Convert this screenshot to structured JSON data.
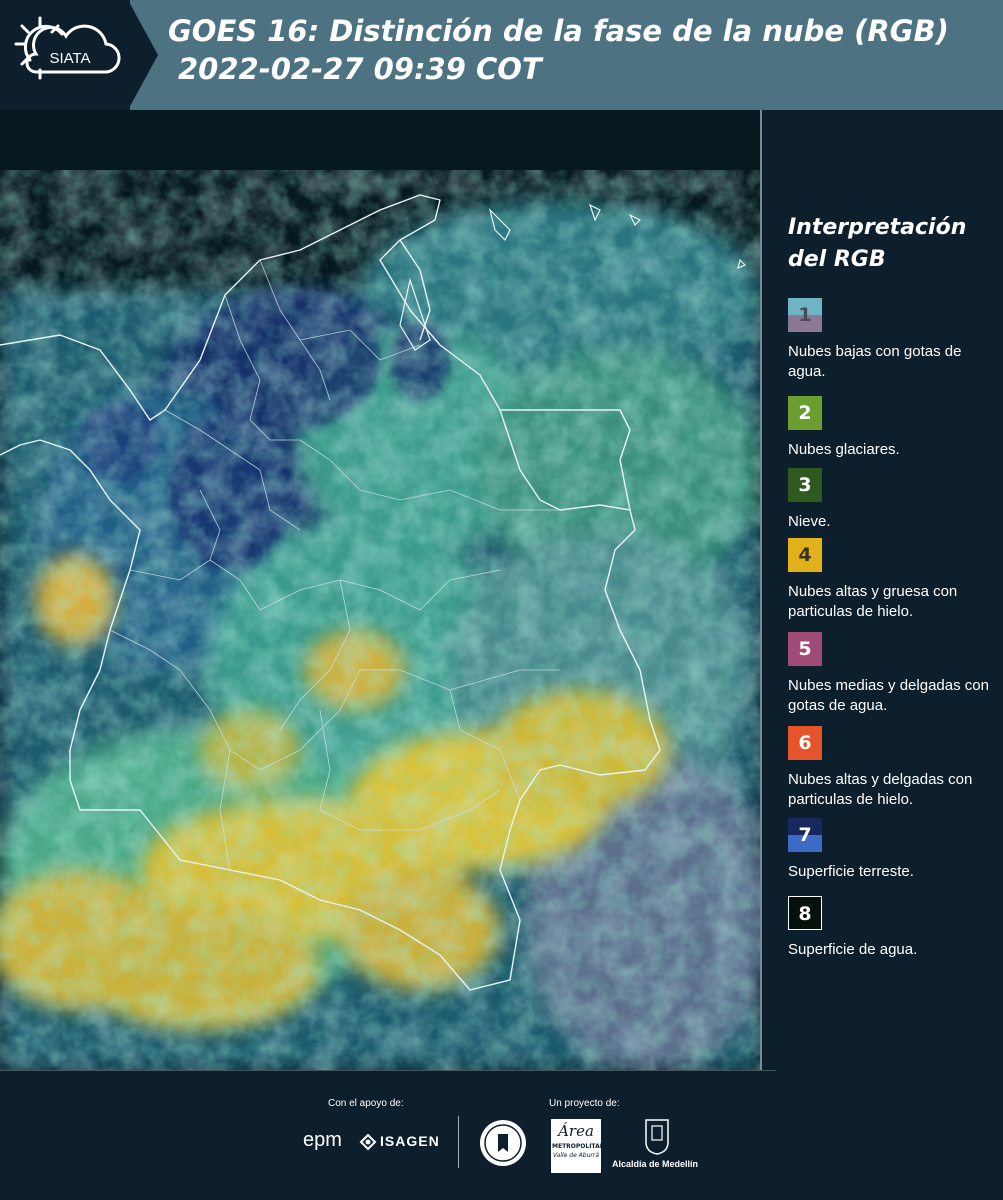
{
  "header": {
    "logo_text": "SIATA",
    "title_line1": "GOES 16: Distinción de la fase de la nube (RGB)",
    "title_line2": "2022-02-27 09:39 COT"
  },
  "legend": {
    "title_line1": "Interpretación",
    "title_line2": "del RGB",
    "items": [
      {
        "number": "1",
        "label": "Nubes bajas con gotas de agua.",
        "color_top": "#6fb4c3",
        "color_bottom": "#8a7896",
        "text_color": "#4a4a55"
      },
      {
        "number": "2",
        "label": "Nubes glaciares.",
        "color_top": "#6a9e2e",
        "color_bottom": "#6a9e2e",
        "text_color": "#ffffff"
      },
      {
        "number": "3",
        "label": "Nieve.",
        "color_top": "#2f5a1e",
        "color_bottom": "#2f5a1e",
        "text_color": "#ffffff"
      },
      {
        "number": "4",
        "label": "Nubes altas y gruesa con particulas de hielo.",
        "color_top": "#e2b11a",
        "color_bottom": "#e2b11a",
        "text_color": "#3a3320"
      },
      {
        "number": "5",
        "label": "Nubes medias y delgadas con gotas de agua.",
        "color_top": "#a04a78",
        "color_bottom": "#a04a78",
        "text_color": "#ffffff"
      },
      {
        "number": "6",
        "label": "Nubes altas y delgadas con particulas de hielo.",
        "color_top": "#e6542b",
        "color_bottom": "#e6542b",
        "text_color": "#ffffff"
      },
      {
        "number": "7",
        "label": "Superficie terreste.",
        "color_top": "#16285e",
        "color_bottom": "#3c6ac4",
        "text_color": "#ffffff"
      },
      {
        "number": "8",
        "label": "Superficie de agua.",
        "color_top": "#05110a",
        "color_bottom": "#05110a",
        "text_color": "#ffffff"
      }
    ]
  },
  "footer": {
    "support_label": "Con el apoyo de:",
    "project_label": "Un proyecto de:",
    "sponsor1": "epm",
    "sponsor2": "ISAGEN",
    "partner1_line1": "Área",
    "partner1_line2": "METROPOLITANA",
    "partner1_line3": "Valle de Aburrá",
    "partner2": "Alcaldía de Medellín"
  }
}
